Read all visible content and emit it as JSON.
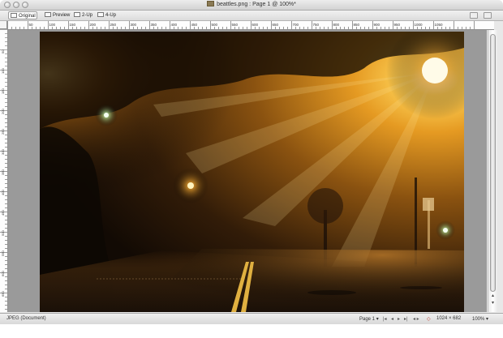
{
  "window": {
    "title": "beattles.png : Page 1 @ 100%*"
  },
  "tabs": [
    {
      "label": "Original",
      "active": true
    },
    {
      "label": "Preview",
      "active": false
    },
    {
      "label": "2-Up",
      "active": false
    },
    {
      "label": "4-Up",
      "active": false
    }
  ],
  "ruler": {
    "top_labels": [
      "50",
      "100",
      "150",
      "200",
      "250",
      "300",
      "350",
      "400",
      "450",
      "500",
      "550",
      "600",
      "650",
      "700",
      "750",
      "800",
      "850",
      "900",
      "950",
      "1000",
      "1050"
    ],
    "left_labels": [
      "50",
      "100",
      "150",
      "200",
      "250",
      "300",
      "350",
      "400",
      "450",
      "500",
      "550",
      "600",
      "650"
    ]
  },
  "status": {
    "document_type": "JPEG (Document)",
    "page": "Page 1",
    "page_arrow": "▾",
    "nav_first": "|◂",
    "nav_prev": "◂",
    "nav_next": "▸",
    "nav_last": "▸|",
    "nav_extra": "◂ ▸",
    "diamond": "◇",
    "dimensions": "1024 × 682",
    "zoom": "100% ▾"
  },
  "icons": {
    "doc": "document-icon",
    "original": "pencil-icon",
    "preview": "preview-icon",
    "two_up": "two-up-icon",
    "four_up": "four-up-icon"
  }
}
